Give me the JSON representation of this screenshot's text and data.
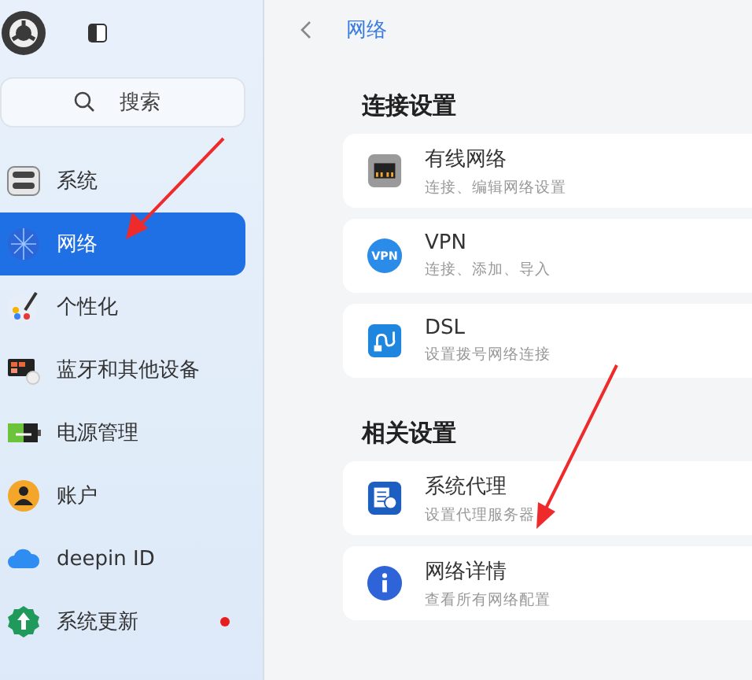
{
  "sidebar": {
    "search": {
      "placeholder": "搜索"
    },
    "items": [
      {
        "label": "系统",
        "selected": false,
        "badge": false
      },
      {
        "label": "网络",
        "selected": true,
        "badge": false
      },
      {
        "label": "个性化",
        "selected": false,
        "badge": false
      },
      {
        "label": "蓝牙和其他设备",
        "selected": false,
        "badge": false
      },
      {
        "label": "电源管理",
        "selected": false,
        "badge": false
      },
      {
        "label": "账户",
        "selected": false,
        "badge": false
      },
      {
        "label": "deepin ID",
        "selected": false,
        "badge": false
      },
      {
        "label": "系统更新",
        "selected": false,
        "badge": true
      }
    ]
  },
  "page": {
    "title": "网络",
    "sections": [
      {
        "heading": "连接设置",
        "items": [
          {
            "title": "有线网络",
            "subtitle": "连接、编辑网络设置"
          },
          {
            "title": "VPN",
            "subtitle": "连接、添加、导入",
            "icon_text": "VPN"
          },
          {
            "title": "DSL",
            "subtitle": "设置拨号网络连接"
          }
        ]
      },
      {
        "heading": "相关设置",
        "items": [
          {
            "title": "系统代理",
            "subtitle": "设置代理服务器"
          },
          {
            "title": "网络详情",
            "subtitle": "查看所有网络配置"
          }
        ]
      }
    ]
  }
}
